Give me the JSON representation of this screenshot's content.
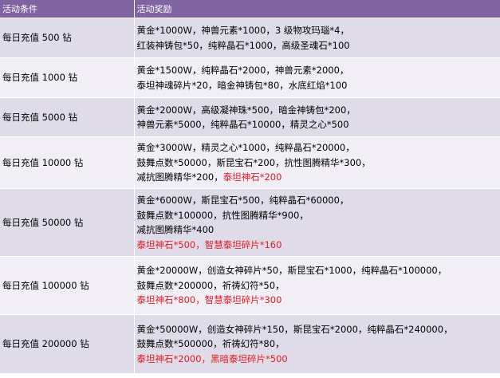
{
  "header": {
    "condition": "活动条件",
    "reward": "活动奖励"
  },
  "rows": [
    {
      "condition": "每日充值 500 钻",
      "lines": [
        [
          {
            "t": "黄金*1000W，神兽元素*1000，3 级物攻玛瑙*4，",
            "red": false
          }
        ],
        [
          {
            "t": "红装神铸包*50，纯粹晶石*1000，高级圣魂石*100",
            "red": false
          }
        ]
      ]
    },
    {
      "condition": "每日充值 1000 钻",
      "lines": [
        [
          {
            "t": "黄金*1500W，纯粹晶石*2000，神兽元素*2000，",
            "red": false
          }
        ],
        [
          {
            "t": "泰坦神魂碎片*20，暗金神铸包*80，水底红焰*100",
            "red": false
          }
        ]
      ]
    },
    {
      "condition": "每日充值 5000 钻",
      "lines": [
        [
          {
            "t": "黄金*2000W，高级凝神珠*500，暗金神铸包*200，",
            "red": false
          }
        ],
        [
          {
            "t": "神兽元素*5000，纯粹晶石*10000，精灵之心*500",
            "red": false
          }
        ]
      ]
    },
    {
      "condition": "每日充值 10000 钻",
      "lines": [
        [
          {
            "t": "黄金*3000W，精灵之心*1000，纯粹晶石*20000，",
            "red": false
          }
        ],
        [
          {
            "t": "鼓舞点数*50000，斯昆宝石*200，抗性图腾精华*300，",
            "red": false
          }
        ],
        [
          {
            "t": "减抗图腾精华*200，",
            "red": false
          },
          {
            "t": "泰坦神石*200",
            "red": true
          }
        ]
      ]
    },
    {
      "condition": "每日充值 50000 钻",
      "lines": [
        [
          {
            "t": "黄金*6000W，斯昆宝石*500，纯粹晶石*60000，",
            "red": false
          }
        ],
        [
          {
            "t": "鼓舞点数*100000，抗性图腾精华*900，",
            "red": false
          }
        ],
        [
          {
            "t": "减抗图腾精华*400",
            "red": false
          }
        ],
        [
          {
            "t": "泰坦神石*500，智慧泰坦碎片*160",
            "red": true
          }
        ]
      ]
    },
    {
      "condition": "每日充值 100000 钻",
      "lines": [
        [
          {
            "t": "黄金*20000W，创造女神碎片*50，斯昆宝石*1000，纯粹晶石*100000，",
            "red": false
          }
        ],
        [
          {
            "t": "鼓舞点数*200000，祈祷幻符*50，",
            "red": false
          }
        ],
        [
          {
            "t": "泰坦神石*800，智慧泰坦碎片*300",
            "red": true
          }
        ]
      ]
    },
    {
      "condition": "每日充值 200000 钻",
      "lines": [
        [
          {
            "t": "黄金*50000W，创造女神碎片*150，斯昆宝石*2000，纯粹晶石*240000，",
            "red": false
          }
        ],
        [
          {
            "t": "鼓舞点数*500000，祈祷幻符*80，",
            "red": false
          }
        ],
        [
          {
            "t": "泰坦神石*2000，黑暗泰坦碎片*500",
            "red": true
          }
        ]
      ]
    }
  ]
}
